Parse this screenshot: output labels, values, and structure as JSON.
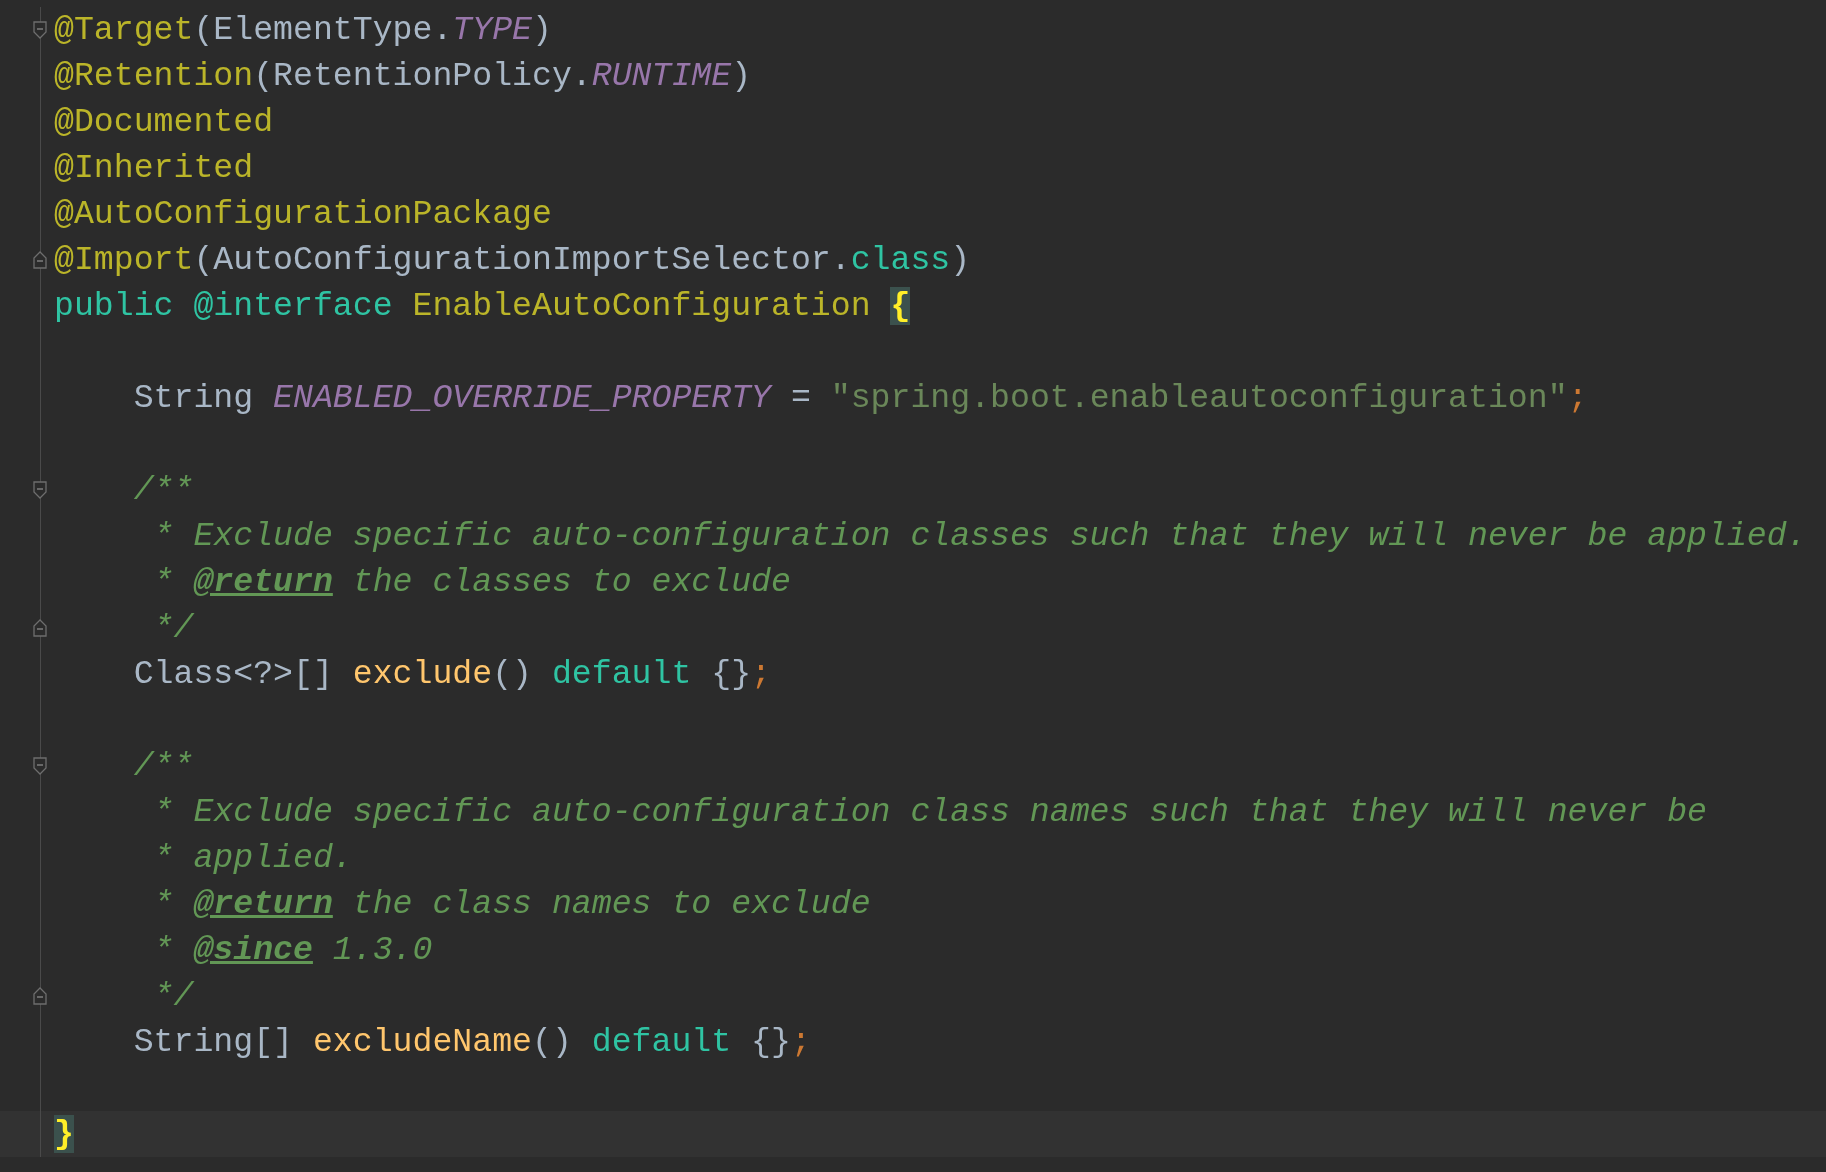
{
  "editor": {
    "lines": [
      {
        "kind": "opener",
        "tokens": [
          {
            "kind": "annotation",
            "text": "@Target"
          },
          {
            "kind": "plain",
            "text": "(ElementType."
          },
          {
            "kind": "constant",
            "text": "TYPE"
          },
          {
            "kind": "plain",
            "text": ")"
          }
        ]
      },
      {
        "kind": "code",
        "tokens": [
          {
            "kind": "annotation",
            "text": "@Retention"
          },
          {
            "kind": "plain",
            "text": "(RetentionPolicy."
          },
          {
            "kind": "constant",
            "text": "RUNTIME"
          },
          {
            "kind": "plain",
            "text": ")"
          }
        ]
      },
      {
        "kind": "code",
        "tokens": [
          {
            "kind": "annotation",
            "text": "@Documented"
          }
        ]
      },
      {
        "kind": "code",
        "tokens": [
          {
            "kind": "annotation",
            "text": "@Inherited"
          }
        ]
      },
      {
        "kind": "code",
        "tokens": [
          {
            "kind": "annotation",
            "text": "@AutoConfigurationPackage"
          }
        ]
      },
      {
        "kind": "closer",
        "tokens": [
          {
            "kind": "annotation",
            "text": "@Import"
          },
          {
            "kind": "plain",
            "text": "(AutoConfigurationImportSelector."
          },
          {
            "kind": "keyword",
            "text": "class"
          },
          {
            "kind": "plain",
            "text": ")"
          }
        ]
      },
      {
        "kind": "code",
        "tokens": [
          {
            "kind": "keyword",
            "text": "public @interface "
          },
          {
            "kind": "classname",
            "text": "EnableAutoConfiguration "
          },
          {
            "kind": "brace",
            "text": "{"
          }
        ]
      },
      {
        "kind": "blank"
      },
      {
        "kind": "code",
        "tokens": [
          {
            "kind": "plain",
            "text": "    String "
          },
          {
            "kind": "constant",
            "text": "ENABLED_OVERRIDE_PROPERTY"
          },
          {
            "kind": "plain",
            "text": " = "
          },
          {
            "kind": "string",
            "text": "\"spring.boot.enableautoconfiguration\""
          },
          {
            "kind": "punct",
            "text": ";"
          }
        ]
      },
      {
        "kind": "blank"
      },
      {
        "kind": "opener",
        "tokens": [
          {
            "kind": "comment",
            "text": "    /**"
          }
        ]
      },
      {
        "kind": "code",
        "tokens": [
          {
            "kind": "comment",
            "text": "     * Exclude specific auto-configuration classes such that they will never be applied."
          }
        ]
      },
      {
        "kind": "code",
        "tokens": [
          {
            "kind": "comment",
            "text": "     * "
          },
          {
            "kind": "doctag",
            "text": "@return"
          },
          {
            "kind": "comment",
            "text": " the classes to exclude"
          }
        ]
      },
      {
        "kind": "closer",
        "tokens": [
          {
            "kind": "comment",
            "text": "     */"
          }
        ]
      },
      {
        "kind": "code",
        "tokens": [
          {
            "kind": "plain",
            "text": "    Class<?>[] "
          },
          {
            "kind": "method",
            "text": "exclude"
          },
          {
            "kind": "plain",
            "text": "() "
          },
          {
            "kind": "keyword",
            "text": "default"
          },
          {
            "kind": "plain",
            "text": " {}"
          },
          {
            "kind": "punct",
            "text": ";"
          }
        ]
      },
      {
        "kind": "blank"
      },
      {
        "kind": "opener",
        "tokens": [
          {
            "kind": "comment",
            "text": "    /**"
          }
        ]
      },
      {
        "kind": "code",
        "tokens": [
          {
            "kind": "comment",
            "text": "     * Exclude specific auto-configuration class names such that they will never be"
          }
        ]
      },
      {
        "kind": "code",
        "tokens": [
          {
            "kind": "comment",
            "text": "     * applied."
          }
        ]
      },
      {
        "kind": "code",
        "tokens": [
          {
            "kind": "comment",
            "text": "     * "
          },
          {
            "kind": "doctag",
            "text": "@return"
          },
          {
            "kind": "comment",
            "text": " the class names to exclude"
          }
        ]
      },
      {
        "kind": "code",
        "tokens": [
          {
            "kind": "comment",
            "text": "     * "
          },
          {
            "kind": "doctag",
            "text": "@since"
          },
          {
            "kind": "comment",
            "text": " 1.3.0"
          }
        ]
      },
      {
        "kind": "closer",
        "tokens": [
          {
            "kind": "comment",
            "text": "     */"
          }
        ]
      },
      {
        "kind": "code",
        "tokens": [
          {
            "kind": "plain",
            "text": "    String[] "
          },
          {
            "kind": "method",
            "text": "excludeName"
          },
          {
            "kind": "plain",
            "text": "() "
          },
          {
            "kind": "keyword",
            "text": "default"
          },
          {
            "kind": "plain",
            "text": " {}"
          },
          {
            "kind": "punct",
            "text": ";"
          }
        ]
      },
      {
        "kind": "blank"
      },
      {
        "kind": "code",
        "current": true,
        "tokens": [
          {
            "kind": "brace",
            "text": "}"
          }
        ]
      }
    ]
  }
}
